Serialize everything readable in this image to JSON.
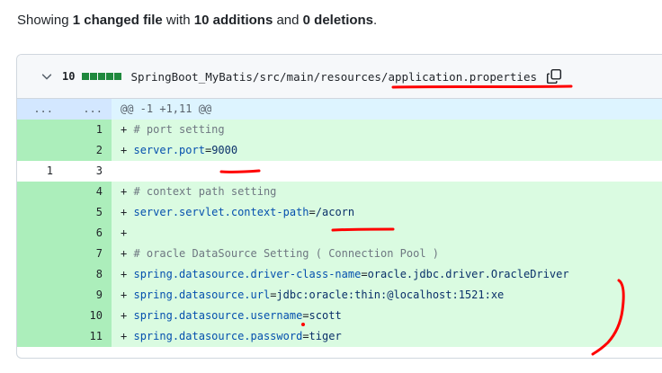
{
  "summary": {
    "prefix": "Showing ",
    "files_changed": "1 changed file",
    "mid1": " with ",
    "additions": "10 additions",
    "mid2": " and ",
    "deletions": "0 deletions",
    "suffix": "."
  },
  "file": {
    "change_count": "10",
    "path_prefix": "SpringBoot_MyBatis/src/main/resources/",
    "filename": "application.properties",
    "icons": {
      "toggle": "chevron-down-icon",
      "copy": "copy-icon"
    },
    "colors": {
      "add_block": "#1f883d",
      "annotation": "#ff0000"
    }
  },
  "diff": {
    "hunk": {
      "old": "...",
      "new": "...",
      "header": "@@ -1 +1,11 @@"
    },
    "lines": [
      {
        "type": "add",
        "old": "",
        "new": "1",
        "sign": "+",
        "key": "# port setting",
        "eq": "",
        "val": "",
        "comment": true
      },
      {
        "type": "add",
        "old": "",
        "new": "2",
        "sign": "+",
        "key": "server.port",
        "eq": "=",
        "val": "9000",
        "comment": false
      },
      {
        "type": "ctx",
        "old": "1",
        "new": "3",
        "sign": "",
        "key": "",
        "eq": "",
        "val": "",
        "comment": false
      },
      {
        "type": "add",
        "old": "",
        "new": "4",
        "sign": "+",
        "key": "# context path setting",
        "eq": "",
        "val": "",
        "comment": true
      },
      {
        "type": "add",
        "old": "",
        "new": "5",
        "sign": "+",
        "key": "server.servlet.context-path",
        "eq": "=",
        "val": "/acorn",
        "comment": false
      },
      {
        "type": "add",
        "old": "",
        "new": "6",
        "sign": "+",
        "key": "",
        "eq": "",
        "val": "",
        "comment": false
      },
      {
        "type": "add",
        "old": "",
        "new": "7",
        "sign": "+",
        "key": "# oracle DataSource Setting ( Connection Pool )",
        "eq": "",
        "val": "",
        "comment": true
      },
      {
        "type": "add",
        "old": "",
        "new": "8",
        "sign": "+",
        "key": "spring.datasource.driver-class-name",
        "eq": "=",
        "val": "oracle.jdbc.driver.OracleDriver",
        "comment": false
      },
      {
        "type": "add",
        "old": "",
        "new": "9",
        "sign": "+",
        "key": "spring.datasource.url",
        "eq": "=",
        "val": "jdbc:oracle:thin:@localhost:1521:xe",
        "comment": false
      },
      {
        "type": "add",
        "old": "",
        "new": "10",
        "sign": "+",
        "key": "spring.datasource.username",
        "eq": "=",
        "val": "scott",
        "comment": false
      },
      {
        "type": "add",
        "old": "",
        "new": "11",
        "sign": "+",
        "key": "spring.datasource.password",
        "eq": "=",
        "val": "tiger",
        "comment": false
      }
    ]
  }
}
